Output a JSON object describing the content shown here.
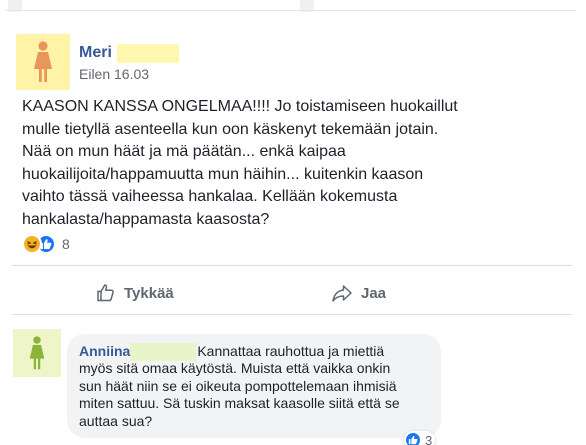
{
  "post": {
    "author": "Meri",
    "time": "Eilen 16.03",
    "lines": [
      "KAASON KANSSA ONGELMAA!!!! Jo toistamiseen huokaillut",
      "mulle tietyllä asenteella kun oon käskenyt tekemään jotain.",
      "Nää on mun häät ja mä päätän... enkä kaipaa",
      "huokailijoita/happamuutta mun häihin... kuitenkin kaason",
      "vaihto tässä vaiheessa hankalaa. Kellään kokemusta",
      "hankalasta/happamasta kaasosta?"
    ],
    "reaction_count": "8",
    "reaction_icons": [
      "haha-icon",
      "like-icon"
    ]
  },
  "actions": {
    "like_label": "Tykkää",
    "share_label": "Jaa"
  },
  "comment": {
    "author": "Anniina",
    "first_line": "Kannattaa rauhottua ja miettiä",
    "lines": [
      "myös sitä omaa käytöstä. Muista että vaikka onkin",
      "sun häät niin se ei oikeuta pompottelemaan ihmisiä",
      "miten sattuu. Sä tuskin maksat kaasolle siitä että se",
      "auttaa sua?"
    ],
    "reaction_count": "3"
  },
  "colors": {
    "link_blue": "#385898",
    "like_blue": "#1877f2",
    "haha_yellow": "#f7b125",
    "meri_avatar_bg": "#fff3a8",
    "anniina_avatar_bg": "#eef6c9",
    "figure_orange": "#e9965a",
    "figure_green": "#8bb33a"
  }
}
